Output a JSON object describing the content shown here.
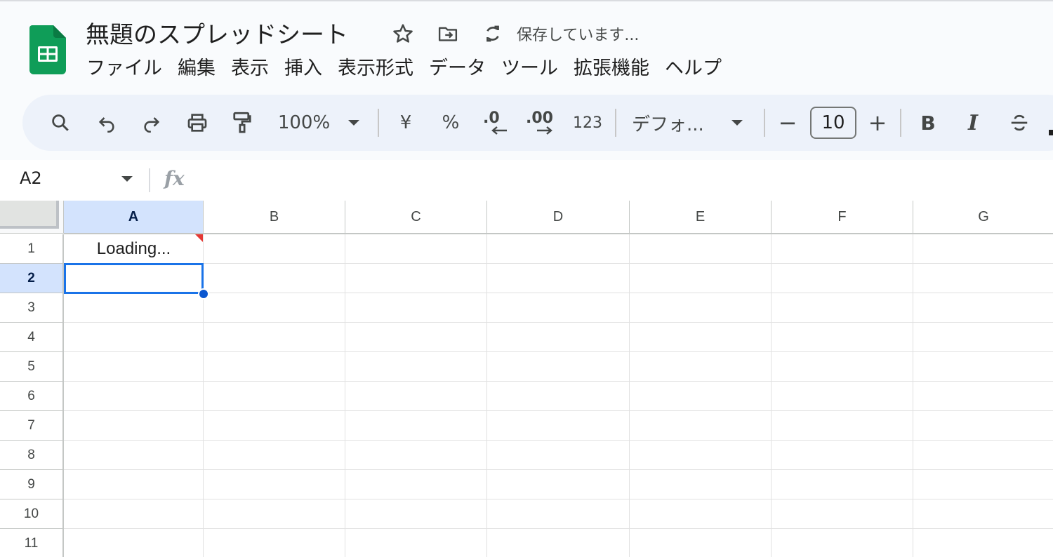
{
  "app": {
    "title": "無題のスプレッドシート",
    "save_status": "保存しています...",
    "brand_color": "#0f9d58"
  },
  "menu": [
    "ファイル",
    "編集",
    "表示",
    "挿入",
    "表示形式",
    "データ",
    "ツール",
    "拡張機能",
    "ヘルプ"
  ],
  "toolbar": {
    "zoom": "100%",
    "currency": "¥",
    "percent": "%",
    "decrease_decimal": ".0",
    "increase_decimal": ".00",
    "number_format": "123",
    "font_family": "デフォ...",
    "minus": "−",
    "font_size": "10",
    "plus": "+",
    "bold": "B",
    "italic": "I"
  },
  "formula_bar": {
    "name_box": "A2",
    "fx": "fx",
    "value": ""
  },
  "grid": {
    "columns": [
      "A",
      "B",
      "C",
      "D",
      "E",
      "F",
      "G"
    ],
    "rows": [
      "1",
      "2",
      "3",
      "4",
      "5",
      "6",
      "7",
      "8",
      "9",
      "10",
      "11"
    ],
    "selected_column": "A",
    "selected_row": "2",
    "cells": {
      "A1": "Loading..."
    }
  },
  "colors": {
    "selection": "#1a73e8",
    "header_selected": "#d3e3fd",
    "comment_marker": "#e53935",
    "toolbar_bg": "#edf2fa"
  }
}
